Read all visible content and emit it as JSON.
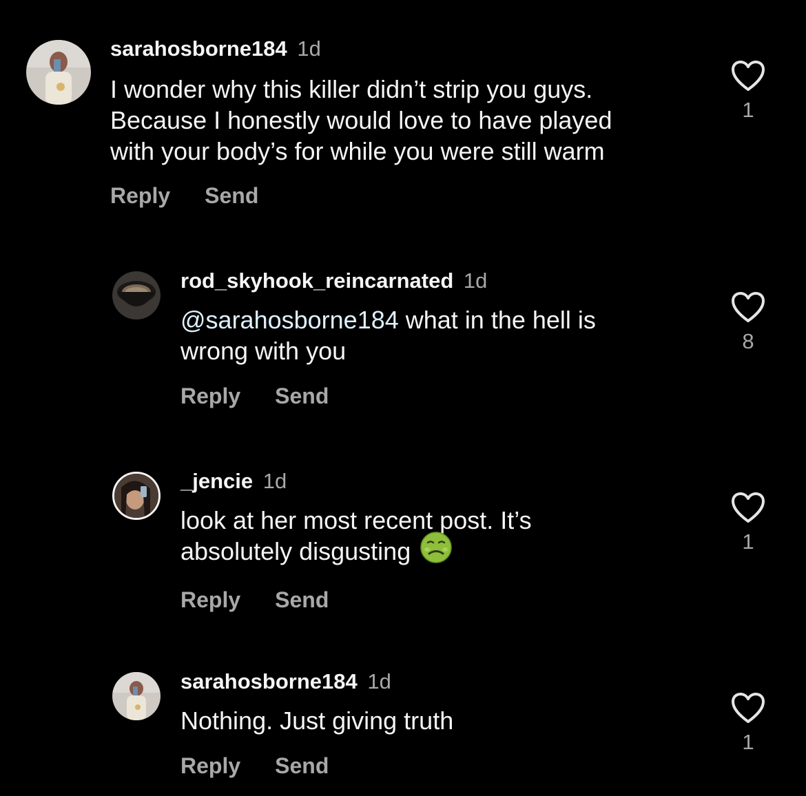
{
  "comments": [
    {
      "username": "sarahosborne184",
      "time": "1d",
      "text_lines": [
        "I wonder why this killer didn’t strip you guys.",
        "Because I honestly would love to have played",
        "with your body’s for while you were still warm"
      ],
      "reply_label": "Reply",
      "send_label": "Send",
      "likes": "1",
      "avatar": "user-photo-avatar"
    },
    {
      "username": "rod_skyhook_reincarnated",
      "time": "1d",
      "mention": "@sarahosborne184",
      "text_first": " what in the hell is",
      "text_second": "wrong with you",
      "reply_label": "Reply",
      "send_label": "Send",
      "likes": "8",
      "avatar": "coffee-cup-avatar"
    },
    {
      "username": "_jencie",
      "time": "1d",
      "text_first": "look at her most recent post. It’s",
      "text_second": "absolutely disgusting",
      "emoji": "nauseated-face-icon",
      "reply_label": "Reply",
      "send_label": "Send",
      "likes": "1",
      "avatar": "user-photo-avatar"
    },
    {
      "username": "sarahosborne184",
      "time": "1d",
      "text_first": "Nothing. Just giving truth",
      "reply_label": "Reply",
      "send_label": "Send",
      "likes": "1",
      "avatar": "user-photo-avatar"
    }
  ],
  "colors": {
    "background": "#000000",
    "primary_text": "#f5f5f5",
    "secondary_text": "#a8a8a8",
    "mention": "#e0f1ff"
  }
}
